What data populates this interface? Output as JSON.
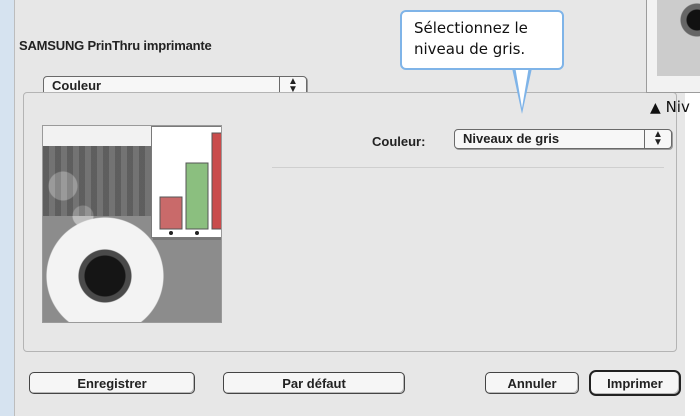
{
  "dialog": {
    "title": "SAMSUNG PrinThru imprimante",
    "section_popup": "Couleur",
    "color_field_label": "Couleur:",
    "color_field_value": "Niveaux de gris",
    "buttons": {
      "save": "Enregistrer",
      "default": "Par défaut",
      "cancel": "Annuler",
      "print": "Imprimer"
    },
    "preview_icon": "sunflower-image"
  },
  "callout": {
    "line1": "Sélectionnez le",
    "line2": "niveau de gris."
  },
  "caption": {
    "marker": "▲",
    "text": "Niv"
  },
  "colors": {
    "callout_border": "#7fb4e8",
    "side_strip": "#d6e3f0",
    "bar1": "#c96a6a",
    "bar2": "#8bbf7f",
    "bar3": "#c94c4c"
  }
}
